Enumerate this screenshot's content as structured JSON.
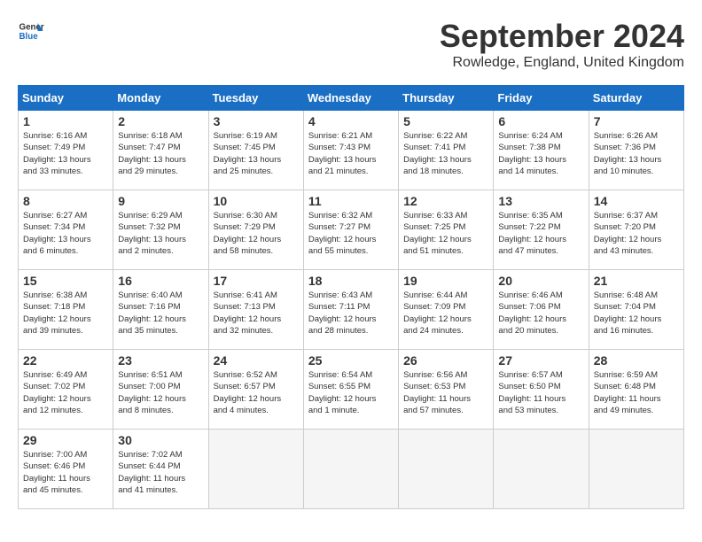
{
  "header": {
    "logo_line1": "General",
    "logo_line2": "Blue",
    "month_title": "September 2024",
    "subtitle": "Rowledge, England, United Kingdom"
  },
  "weekdays": [
    "Sunday",
    "Monday",
    "Tuesday",
    "Wednesday",
    "Thursday",
    "Friday",
    "Saturday"
  ],
  "weeks": [
    [
      {
        "day": "1",
        "info": "Sunrise: 6:16 AM\nSunset: 7:49 PM\nDaylight: 13 hours\nand 33 minutes."
      },
      {
        "day": "2",
        "info": "Sunrise: 6:18 AM\nSunset: 7:47 PM\nDaylight: 13 hours\nand 29 minutes."
      },
      {
        "day": "3",
        "info": "Sunrise: 6:19 AM\nSunset: 7:45 PM\nDaylight: 13 hours\nand 25 minutes."
      },
      {
        "day": "4",
        "info": "Sunrise: 6:21 AM\nSunset: 7:43 PM\nDaylight: 13 hours\nand 21 minutes."
      },
      {
        "day": "5",
        "info": "Sunrise: 6:22 AM\nSunset: 7:41 PM\nDaylight: 13 hours\nand 18 minutes."
      },
      {
        "day": "6",
        "info": "Sunrise: 6:24 AM\nSunset: 7:38 PM\nDaylight: 13 hours\nand 14 minutes."
      },
      {
        "day": "7",
        "info": "Sunrise: 6:26 AM\nSunset: 7:36 PM\nDaylight: 13 hours\nand 10 minutes."
      }
    ],
    [
      {
        "day": "8",
        "info": "Sunrise: 6:27 AM\nSunset: 7:34 PM\nDaylight: 13 hours\nand 6 minutes."
      },
      {
        "day": "9",
        "info": "Sunrise: 6:29 AM\nSunset: 7:32 PM\nDaylight: 13 hours\nand 2 minutes."
      },
      {
        "day": "10",
        "info": "Sunrise: 6:30 AM\nSunset: 7:29 PM\nDaylight: 12 hours\nand 58 minutes."
      },
      {
        "day": "11",
        "info": "Sunrise: 6:32 AM\nSunset: 7:27 PM\nDaylight: 12 hours\nand 55 minutes."
      },
      {
        "day": "12",
        "info": "Sunrise: 6:33 AM\nSunset: 7:25 PM\nDaylight: 12 hours\nand 51 minutes."
      },
      {
        "day": "13",
        "info": "Sunrise: 6:35 AM\nSunset: 7:22 PM\nDaylight: 12 hours\nand 47 minutes."
      },
      {
        "day": "14",
        "info": "Sunrise: 6:37 AM\nSunset: 7:20 PM\nDaylight: 12 hours\nand 43 minutes."
      }
    ],
    [
      {
        "day": "15",
        "info": "Sunrise: 6:38 AM\nSunset: 7:18 PM\nDaylight: 12 hours\nand 39 minutes."
      },
      {
        "day": "16",
        "info": "Sunrise: 6:40 AM\nSunset: 7:16 PM\nDaylight: 12 hours\nand 35 minutes."
      },
      {
        "day": "17",
        "info": "Sunrise: 6:41 AM\nSunset: 7:13 PM\nDaylight: 12 hours\nand 32 minutes."
      },
      {
        "day": "18",
        "info": "Sunrise: 6:43 AM\nSunset: 7:11 PM\nDaylight: 12 hours\nand 28 minutes."
      },
      {
        "day": "19",
        "info": "Sunrise: 6:44 AM\nSunset: 7:09 PM\nDaylight: 12 hours\nand 24 minutes."
      },
      {
        "day": "20",
        "info": "Sunrise: 6:46 AM\nSunset: 7:06 PM\nDaylight: 12 hours\nand 20 minutes."
      },
      {
        "day": "21",
        "info": "Sunrise: 6:48 AM\nSunset: 7:04 PM\nDaylight: 12 hours\nand 16 minutes."
      }
    ],
    [
      {
        "day": "22",
        "info": "Sunrise: 6:49 AM\nSunset: 7:02 PM\nDaylight: 12 hours\nand 12 minutes."
      },
      {
        "day": "23",
        "info": "Sunrise: 6:51 AM\nSunset: 7:00 PM\nDaylight: 12 hours\nand 8 minutes."
      },
      {
        "day": "24",
        "info": "Sunrise: 6:52 AM\nSunset: 6:57 PM\nDaylight: 12 hours\nand 4 minutes."
      },
      {
        "day": "25",
        "info": "Sunrise: 6:54 AM\nSunset: 6:55 PM\nDaylight: 12 hours\nand 1 minute."
      },
      {
        "day": "26",
        "info": "Sunrise: 6:56 AM\nSunset: 6:53 PM\nDaylight: 11 hours\nand 57 minutes."
      },
      {
        "day": "27",
        "info": "Sunrise: 6:57 AM\nSunset: 6:50 PM\nDaylight: 11 hours\nand 53 minutes."
      },
      {
        "day": "28",
        "info": "Sunrise: 6:59 AM\nSunset: 6:48 PM\nDaylight: 11 hours\nand 49 minutes."
      }
    ],
    [
      {
        "day": "29",
        "info": "Sunrise: 7:00 AM\nSunset: 6:46 PM\nDaylight: 11 hours\nand 45 minutes."
      },
      {
        "day": "30",
        "info": "Sunrise: 7:02 AM\nSunset: 6:44 PM\nDaylight: 11 hours\nand 41 minutes."
      },
      {
        "day": "",
        "info": ""
      },
      {
        "day": "",
        "info": ""
      },
      {
        "day": "",
        "info": ""
      },
      {
        "day": "",
        "info": ""
      },
      {
        "day": "",
        "info": ""
      }
    ]
  ]
}
